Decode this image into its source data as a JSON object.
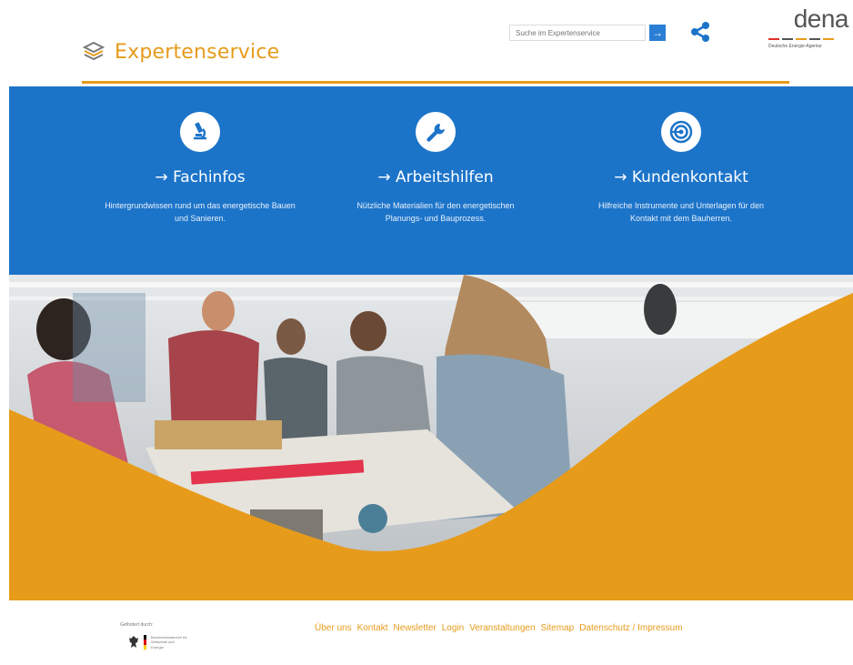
{
  "header": {
    "brand_title": "Expertenservice",
    "search_placeholder": "Suche im Expertenservice",
    "search_button_glyph": "→",
    "share_icon": "share-icon",
    "partner_logo_text": "dena",
    "partner_logo_subtitle": "Deutsche Energie-Agentur"
  },
  "columns": [
    {
      "icon": "microscope-icon",
      "title": "→ Fachinfos",
      "description": "Hintergrundwissen rund um das energetische Bauen und Sanieren."
    },
    {
      "icon": "wrench-icon",
      "title": "→ Arbeitshilfen",
      "description": "Nützliche Materialien für den energetischen Planungs- und Bauprozess."
    },
    {
      "icon": "target-icon",
      "title": "→ Kundenkontakt",
      "description": "Hilfreiche Instrumente und Unterlagen für den Kontakt mit dem Bauherren."
    }
  ],
  "footer": {
    "funding_label": "Gefördert durch:",
    "ministry_text": "Bundesministerium für Wirtschaft und Energie",
    "nav": [
      "Über uns",
      "Kontakt",
      "Newsletter",
      "Login",
      "Veranstaltungen",
      "Sitemap",
      "Datenschutz / Impressum"
    ]
  },
  "colors": {
    "brand_orange": "#e79b1b",
    "brand_blue": "#1c74c9",
    "white": "#ffffff"
  }
}
